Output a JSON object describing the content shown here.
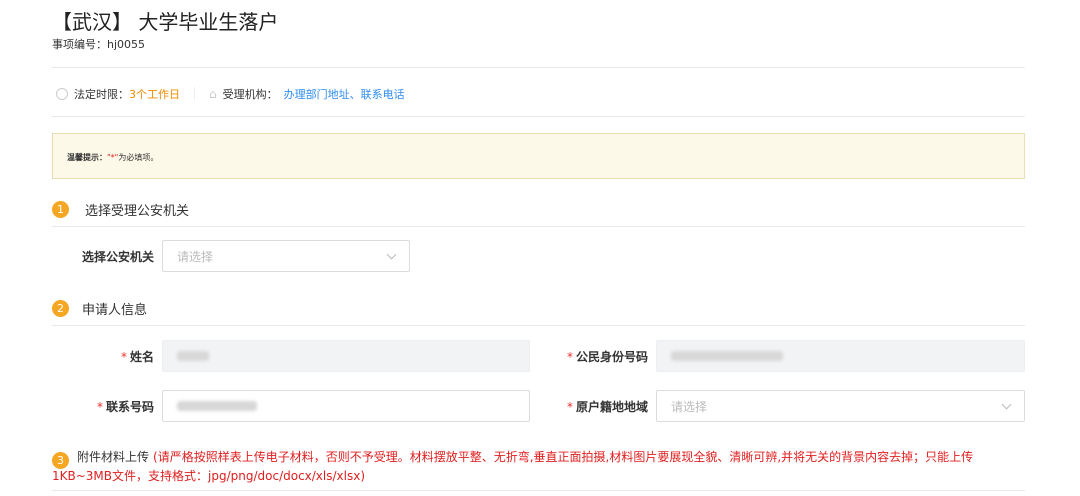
{
  "header": {
    "title": "【武汉】 大学毕业生落户",
    "code_label": "事项编号：",
    "code": "hj0055"
  },
  "info": {
    "time_label": "法定时限：",
    "time_value": "3个工作日",
    "org_label": "受理机构：",
    "org_link": "办理部门地址、联系电话"
  },
  "tip": {
    "label": "温馨提示：",
    "star": "\"*\"",
    "text": "为必填项。"
  },
  "sections": [
    {
      "num": "1",
      "title": "选择受理公安机关"
    },
    {
      "num": "2",
      "title": "申请人信息"
    },
    {
      "num": "3",
      "title": "附件材料上传",
      "note": "(请严格按照样表上传电子材料，否则不予受理。材料摆放平整、无折弯,垂直正面拍摄,材料图片要展现全貌、清晰可辨,并将无关的背景内容去掉；只能上传1KB~3MB文件，支持格式：jpg/png/doc/docx/xls/xlsx)"
    }
  ],
  "form": {
    "police_label": "选择公安机关",
    "police_placeholder": "请选择",
    "star": "*",
    "name_label": "姓名",
    "id_label": "公民身份号码",
    "phone_label": "联系号码",
    "hukou_label": "原户籍地地域",
    "hukou_placeholder": "请选择"
  },
  "colors": {
    "accent": "#f5a623",
    "link": "#2d8cf0",
    "warning": "#e02020"
  }
}
